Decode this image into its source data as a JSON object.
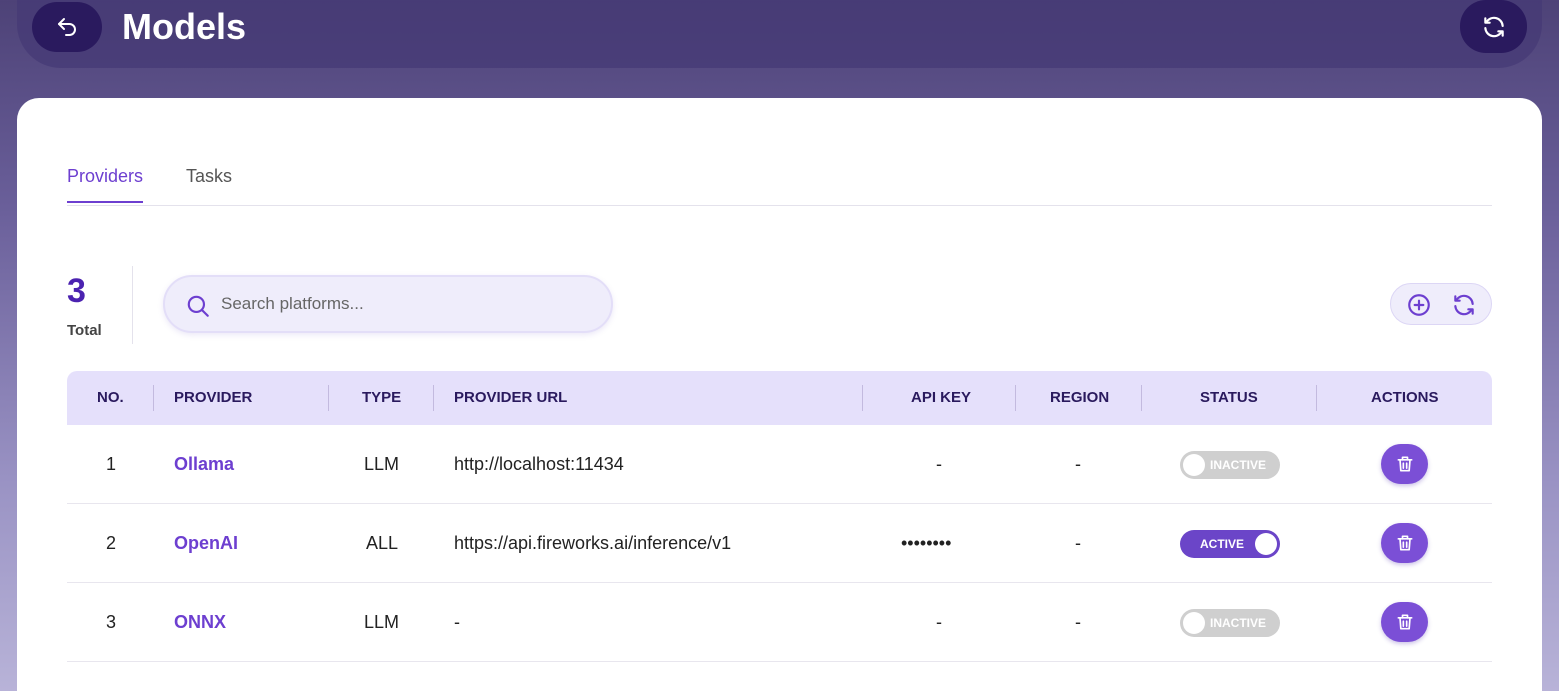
{
  "header": {
    "title": "Models",
    "back_icon": "back-arrow-icon",
    "refresh_icon": "refresh-icon"
  },
  "tabs": [
    {
      "label": "Providers",
      "active": true
    },
    {
      "label": "Tasks",
      "active": false
    }
  ],
  "summary": {
    "total_count": "3",
    "total_label": "Total"
  },
  "search": {
    "placeholder": "Search platforms...",
    "value": ""
  },
  "table": {
    "columns": [
      "NO.",
      "PROVIDER",
      "TYPE",
      "PROVIDER URL",
      "API KEY",
      "REGION",
      "STATUS",
      "ACTIONS"
    ],
    "rows": [
      {
        "no": "1",
        "provider": "Ollama",
        "type": "LLM",
        "url": "http://localhost:11434",
        "api_key": "-",
        "region": "-",
        "status": "INACTIVE"
      },
      {
        "no": "2",
        "provider": "OpenAI",
        "type": "ALL",
        "url": "https://api.fireworks.ai/inference/v1",
        "api_key": "••••••••",
        "region": "-",
        "status": "ACTIVE"
      },
      {
        "no": "3",
        "provider": "ONNX",
        "type": "LLM",
        "url": "-",
        "api_key": "-",
        "region": "-",
        "status": "INACTIVE"
      }
    ]
  },
  "colors": {
    "accent": "#6d3fd0",
    "header_dark": "#2a1a5e",
    "table_header_bg": "#e5e0fb",
    "toggle_on": "#6b45c8",
    "toggle_off": "#cfcfcf"
  }
}
